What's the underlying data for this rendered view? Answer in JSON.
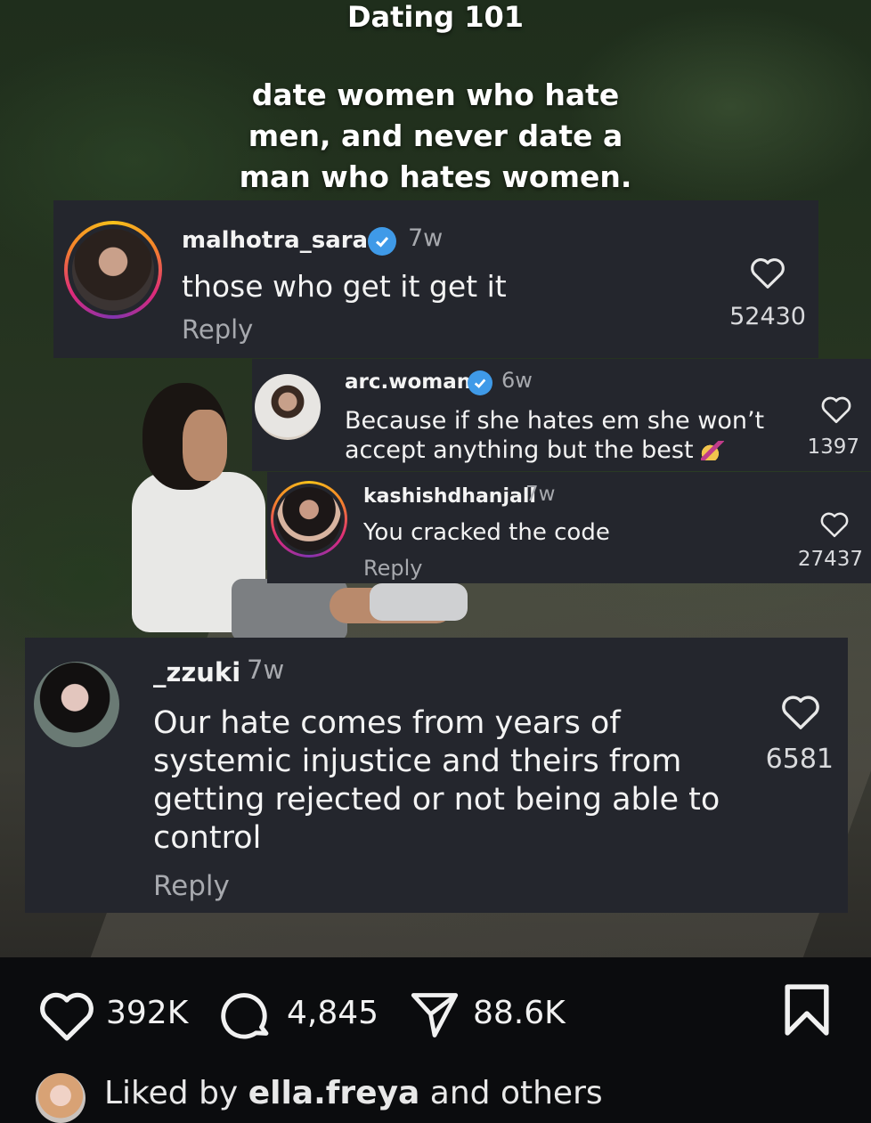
{
  "overlay": {
    "title": "Dating 101",
    "body_lines": [
      "date women who hate",
      "men, and never date a",
      "man who hates women."
    ]
  },
  "comments": [
    {
      "username": "malhotra_sara",
      "verified": true,
      "time": "7w",
      "text": "those who get it get it",
      "reply_label": "Reply",
      "likes": "52430"
    },
    {
      "username": "arc.woman",
      "verified": true,
      "time": "6w",
      "text_lines": [
        "Because if she hates em she won’t",
        "accept anything but the best"
      ],
      "emoji": "nail-polish-icon",
      "likes": "1397"
    },
    {
      "username": "kashishdhanjall",
      "verified": false,
      "time": "7w",
      "text": "You cracked the code",
      "reply_label": "Reply",
      "likes": "27437"
    },
    {
      "username": "_zzuki",
      "verified": false,
      "time": "7w",
      "text_lines": [
        "Our hate comes from years of",
        "systemic injustice and theirs from",
        "getting rejected or not being able to",
        "control"
      ],
      "reply_label": "Reply",
      "likes": "6581"
    }
  ],
  "actions": {
    "likes": "392K",
    "comments": "4,845",
    "shares": "88.6K",
    "icons": [
      "heart-icon",
      "comment-icon",
      "share-icon",
      "bookmark-icon"
    ]
  },
  "liked_by": {
    "prefix": "Liked by",
    "user": "ella.freya",
    "suffix": "and others"
  },
  "colors": {
    "card_bg": "#24262d",
    "verified_blue": "#3f9ae8",
    "muted_text": "#a7a9ae"
  }
}
